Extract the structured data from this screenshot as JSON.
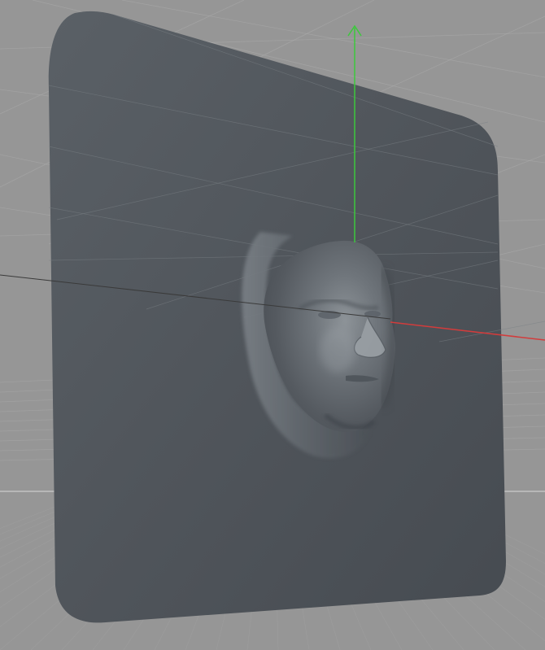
{
  "viewport": {
    "background_color": "#969696",
    "grid_color": "#aaaaaa",
    "horizon_line_color": "#d8d8d8",
    "object": {
      "kind": "displaced plane with sculpted face relief",
      "surface_color": "#4f545a"
    },
    "axes": {
      "y_axis_color": "#3cc83c",
      "x_axis_color": "#d23c3c",
      "z_axis_color": "#3a3a3a"
    }
  }
}
